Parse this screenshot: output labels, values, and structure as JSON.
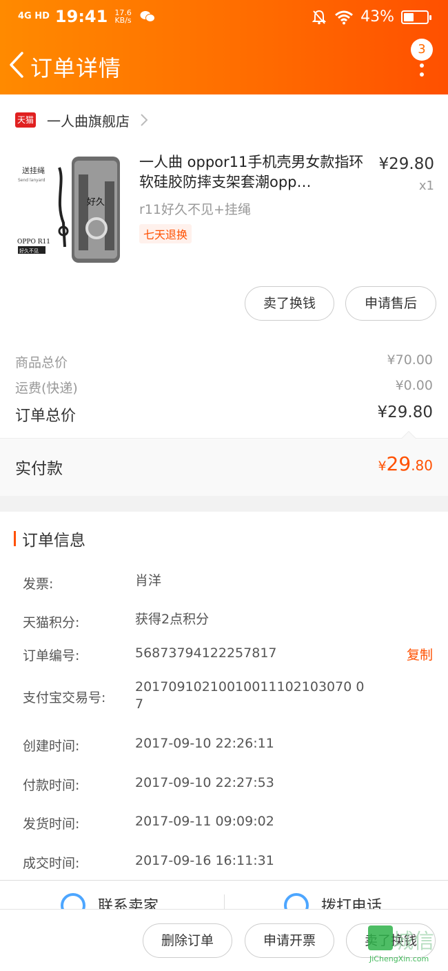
{
  "status_bar": {
    "network": "4G HD",
    "time": "19:41",
    "speed": "17.6",
    "speed_unit": "KB/s",
    "battery_percent": "43%",
    "battery_level": 0.43
  },
  "header": {
    "title": "订单详情",
    "badge_count": "3"
  },
  "shop": {
    "tag": "天猫",
    "name": "一人曲旗舰店"
  },
  "product": {
    "title": "一人曲 oppor11手机壳男女款指环软硅胶防摔支架套潮opp…",
    "sku": "r11好久不见+挂绳",
    "tag": "七天退换",
    "price": "¥29.80",
    "qty": "x1",
    "image_texts": {
      "lanyard": "送挂绳",
      "lanyard_en": "Send lanyard",
      "model": "OPPO R11",
      "slogan": "好久不见"
    }
  },
  "product_actions": {
    "sell_label": "卖了换钱",
    "aftersale_label": "申请售后"
  },
  "summary": {
    "goods_label": "商品总价",
    "goods_value": "¥70.00",
    "shipping_label": "运费(快递)",
    "shipping_value": "¥0.00",
    "total_label": "订单总价",
    "total_value": "¥29.80"
  },
  "paid": {
    "label": "实付款",
    "symbol": "¥",
    "integer": "29",
    "decimal": ".80"
  },
  "order_info": {
    "title": "订单信息",
    "copy_label": "复制",
    "rows": [
      {
        "label": "发票:",
        "value": "肖洋"
      },
      {
        "label": "天猫积分:",
        "value": "获得2点积分"
      },
      {
        "label": "订单编号:",
        "value": "56873794122257817"
      },
      {
        "label": "支付宝交易号:",
        "value": "20170910210010011102103070 07"
      },
      {
        "label": "创建时间:",
        "value": "2017-09-10 22:26:11"
      },
      {
        "label": "付款时间:",
        "value": "2017-09-10 22:27:53"
      },
      {
        "label": "发货时间:",
        "value": "2017-09-11 09:09:02"
      },
      {
        "label": "成交时间:",
        "value": "2017-09-16 16:11:31"
      }
    ]
  },
  "contact": {
    "seller_label": "联系卖家",
    "phone_label": "拨打电话"
  },
  "bottom_actions": {
    "delete_label": "删除订单",
    "invoice_label": "申请开票",
    "sell_label": "卖了换钱"
  },
  "watermark": {
    "text": "城信",
    "url": "JiChengXin.com"
  }
}
